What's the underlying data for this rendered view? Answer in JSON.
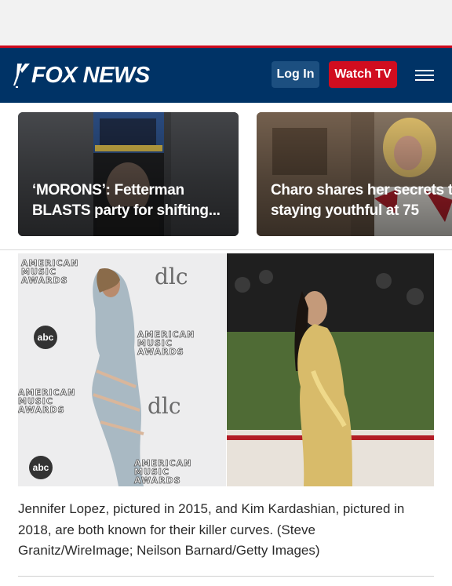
{
  "header": {
    "logo_text": "FOX NEWS",
    "login_label": "Log In",
    "watch_label": "Watch TV",
    "colors": {
      "bar": "#003366",
      "accent": "#d10d1f",
      "login_bg": "#1c4f80"
    }
  },
  "cards": [
    {
      "title_line1": "‘MORONS’: Fetterman",
      "title_line2": "BLASTS party for shifting..."
    },
    {
      "title_line1": "Charo shares her secrets to",
      "title_line2": "staying youthful at 75"
    }
  ],
  "photo": {
    "logos": {
      "ama_1": "AMERICAN MUSIC AWARDS",
      "dlc": "dlc",
      "abc": "abc"
    }
  },
  "caption": "Jennifer Lopez, pictured in 2015, and Kim Kardashian, pictured in 2018, are both known for their killer curves. (Steve Granitz/WireImage; Neilson Barnard/Getty Images)"
}
